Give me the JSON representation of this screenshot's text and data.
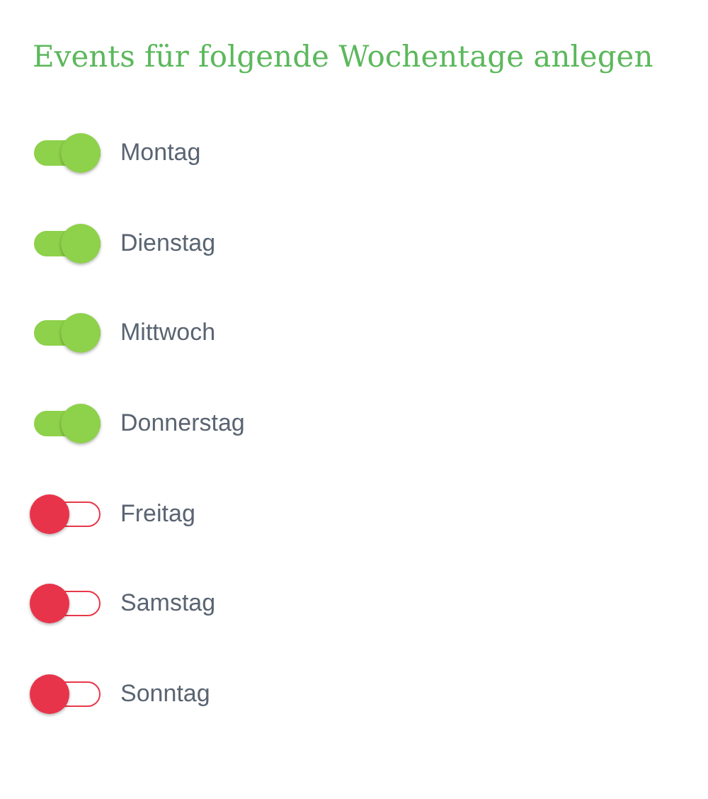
{
  "title": "Events für folgende Wochentage anlegen",
  "days": [
    {
      "label": "Montag",
      "on": true
    },
    {
      "label": "Dienstag",
      "on": true
    },
    {
      "label": "Mittwoch",
      "on": true
    },
    {
      "label": "Donnerstag",
      "on": true
    },
    {
      "label": "Freitag",
      "on": false
    },
    {
      "label": "Samstag",
      "on": false
    },
    {
      "label": "Sonntag",
      "on": false
    }
  ]
}
